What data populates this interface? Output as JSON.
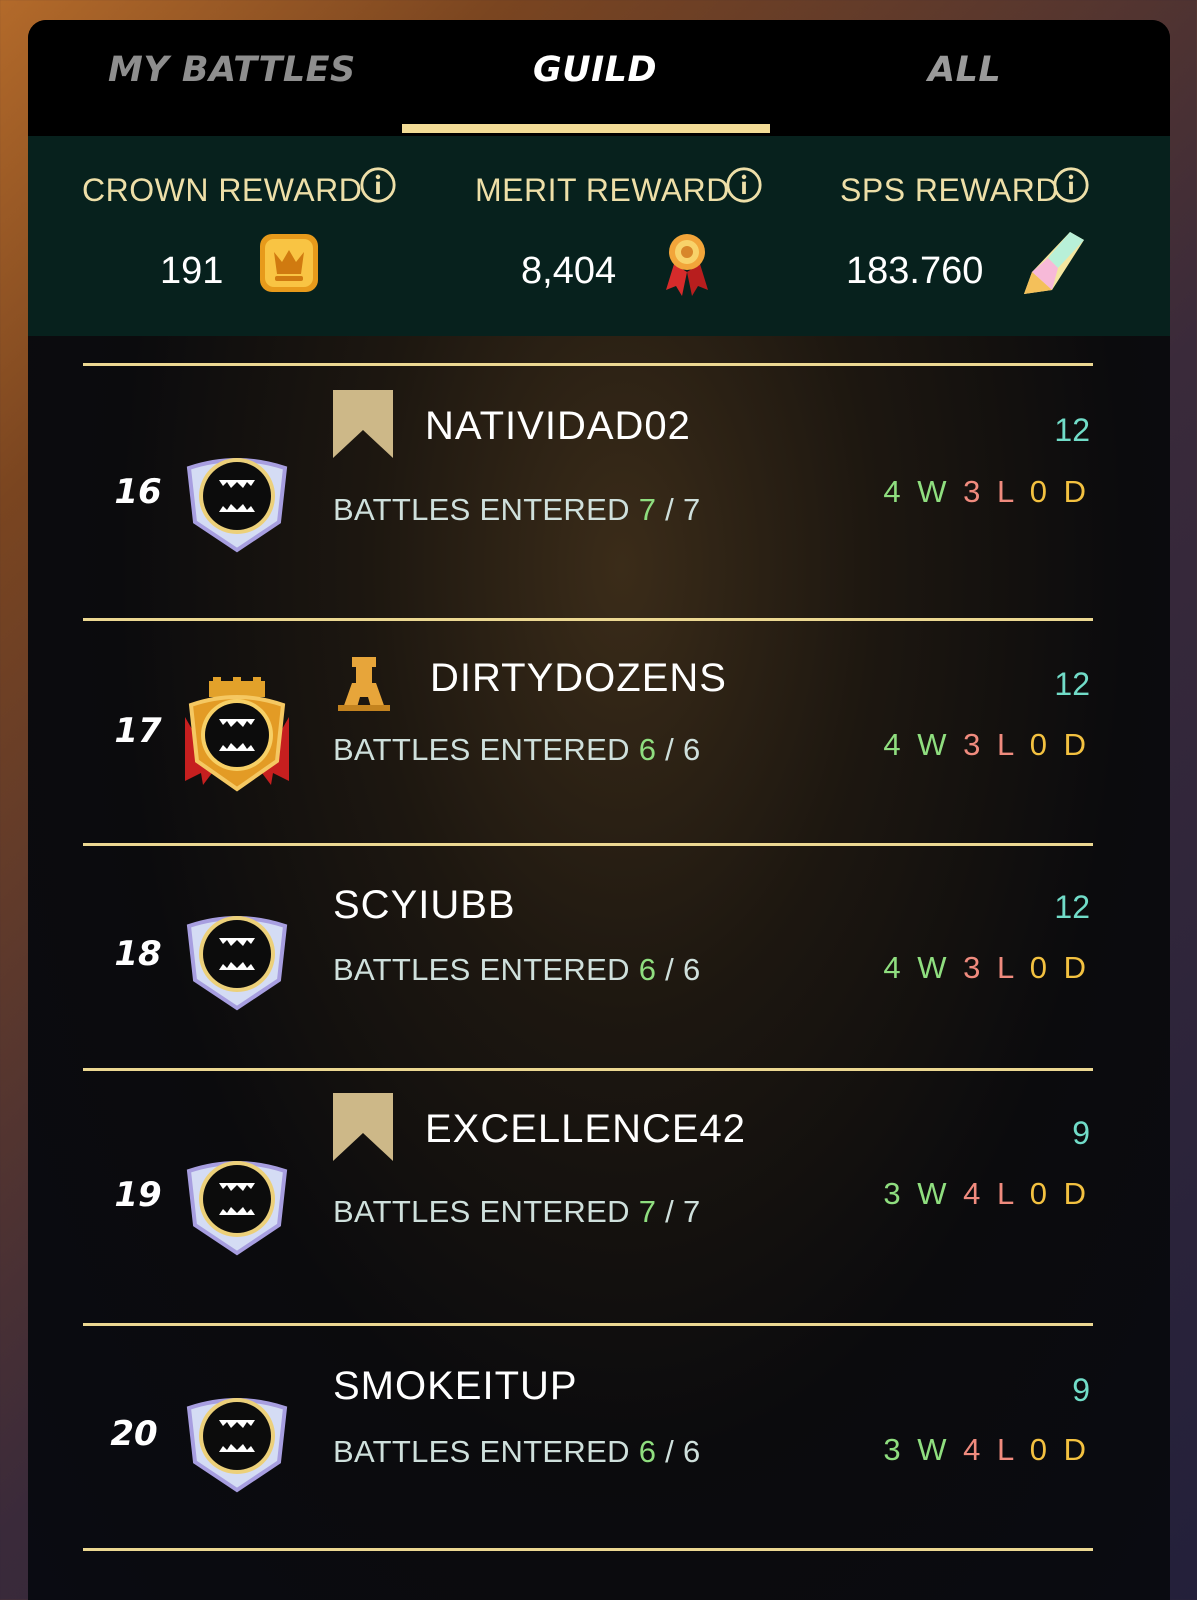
{
  "tabs": [
    {
      "label": "MY BATTLES",
      "active": false
    },
    {
      "label": "GUILD",
      "active": true
    },
    {
      "label": "ALL",
      "active": false
    }
  ],
  "rewards": {
    "crown": {
      "label": "CROWN REWARD",
      "value": "191",
      "icon": "crown-token-icon"
    },
    "merit": {
      "label": "MERIT REWARD",
      "value": "8,404",
      "icon": "merit-medal-icon"
    },
    "sps": {
      "label": "SPS REWARD",
      "value": "183.760",
      "icon": "sps-crystal-icon"
    }
  },
  "rows": [
    {
      "rank": "16",
      "name": "NATIVIDAD02",
      "role_icon": "bookmark-icon",
      "entered_label": "BATTLES ENTERED",
      "entered": "7",
      "total": "7",
      "score": "12",
      "w": "4",
      "l": "3",
      "d": "0"
    },
    {
      "rank": "17",
      "name": "DIRTYDOZENS",
      "role_icon": "castle-icon",
      "entered_label": "BATTLES ENTERED",
      "entered": "6",
      "total": "6",
      "score": "12",
      "w": "4",
      "l": "3",
      "d": "0"
    },
    {
      "rank": "18",
      "name": "SCYIUBB",
      "role_icon": "",
      "entered_label": "BATTLES ENTERED",
      "entered": "6",
      "total": "6",
      "score": "12",
      "w": "4",
      "l": "3",
      "d": "0"
    },
    {
      "rank": "19",
      "name": "EXCELLENCE42",
      "role_icon": "bookmark-icon",
      "entered_label": "BATTLES ENTERED",
      "entered": "7",
      "total": "7",
      "score": "9",
      "w": "3",
      "l": "4",
      "d": "0"
    },
    {
      "rank": "20",
      "name": "SMOKEITUP",
      "role_icon": "",
      "entered_label": "BATTLES ENTERED",
      "entered": "6",
      "total": "6",
      "score": "9",
      "w": "3",
      "l": "4",
      "d": "0"
    }
  ],
  "record_units": {
    "w": "W",
    "l": "L",
    "d": "D"
  },
  "colors": {
    "accent": "#f2dc96",
    "win": "#8fde7f",
    "loss": "#f08b7e",
    "draw": "#f3c140",
    "score": "#71dcc8",
    "rewards_bg": "#07211d"
  }
}
